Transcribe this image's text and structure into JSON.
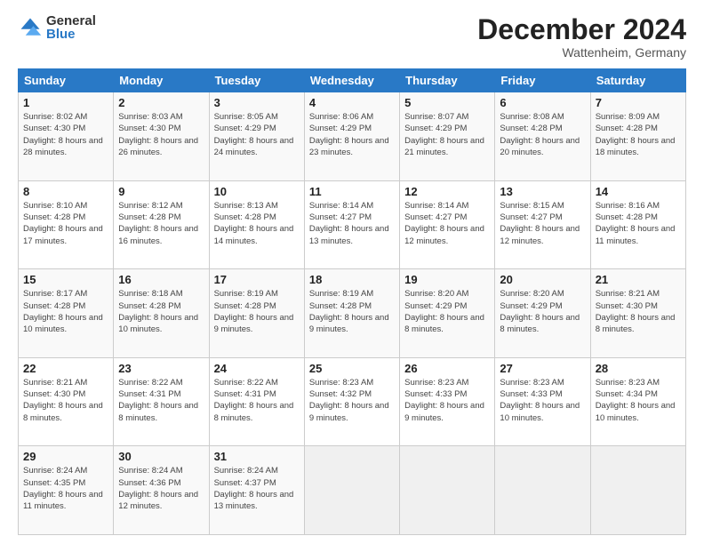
{
  "logo": {
    "general": "General",
    "blue": "Blue"
  },
  "title": "December 2024",
  "location": "Wattenheim, Germany",
  "days_of_week": [
    "Sunday",
    "Monday",
    "Tuesday",
    "Wednesday",
    "Thursday",
    "Friday",
    "Saturday"
  ],
  "weeks": [
    [
      {
        "day": "1",
        "sunrise": "8:02 AM",
        "sunset": "4:30 PM",
        "daylight": "8 hours and 28 minutes."
      },
      {
        "day": "2",
        "sunrise": "8:03 AM",
        "sunset": "4:30 PM",
        "daylight": "8 hours and 26 minutes."
      },
      {
        "day": "3",
        "sunrise": "8:05 AM",
        "sunset": "4:29 PM",
        "daylight": "8 hours and 24 minutes."
      },
      {
        "day": "4",
        "sunrise": "8:06 AM",
        "sunset": "4:29 PM",
        "daylight": "8 hours and 23 minutes."
      },
      {
        "day": "5",
        "sunrise": "8:07 AM",
        "sunset": "4:29 PM",
        "daylight": "8 hours and 21 minutes."
      },
      {
        "day": "6",
        "sunrise": "8:08 AM",
        "sunset": "4:28 PM",
        "daylight": "8 hours and 20 minutes."
      },
      {
        "day": "7",
        "sunrise": "8:09 AM",
        "sunset": "4:28 PM",
        "daylight": "8 hours and 18 minutes."
      }
    ],
    [
      {
        "day": "8",
        "sunrise": "8:10 AM",
        "sunset": "4:28 PM",
        "daylight": "8 hours and 17 minutes."
      },
      {
        "day": "9",
        "sunrise": "8:12 AM",
        "sunset": "4:28 PM",
        "daylight": "8 hours and 16 minutes."
      },
      {
        "day": "10",
        "sunrise": "8:13 AM",
        "sunset": "4:28 PM",
        "daylight": "8 hours and 14 minutes."
      },
      {
        "day": "11",
        "sunrise": "8:14 AM",
        "sunset": "4:27 PM",
        "daylight": "8 hours and 13 minutes."
      },
      {
        "day": "12",
        "sunrise": "8:14 AM",
        "sunset": "4:27 PM",
        "daylight": "8 hours and 12 minutes."
      },
      {
        "day": "13",
        "sunrise": "8:15 AM",
        "sunset": "4:27 PM",
        "daylight": "8 hours and 12 minutes."
      },
      {
        "day": "14",
        "sunrise": "8:16 AM",
        "sunset": "4:28 PM",
        "daylight": "8 hours and 11 minutes."
      }
    ],
    [
      {
        "day": "15",
        "sunrise": "8:17 AM",
        "sunset": "4:28 PM",
        "daylight": "8 hours and 10 minutes."
      },
      {
        "day": "16",
        "sunrise": "8:18 AM",
        "sunset": "4:28 PM",
        "daylight": "8 hours and 10 minutes."
      },
      {
        "day": "17",
        "sunrise": "8:19 AM",
        "sunset": "4:28 PM",
        "daylight": "8 hours and 9 minutes."
      },
      {
        "day": "18",
        "sunrise": "8:19 AM",
        "sunset": "4:28 PM",
        "daylight": "8 hours and 9 minutes."
      },
      {
        "day": "19",
        "sunrise": "8:20 AM",
        "sunset": "4:29 PM",
        "daylight": "8 hours and 8 minutes."
      },
      {
        "day": "20",
        "sunrise": "8:20 AM",
        "sunset": "4:29 PM",
        "daylight": "8 hours and 8 minutes."
      },
      {
        "day": "21",
        "sunrise": "8:21 AM",
        "sunset": "4:30 PM",
        "daylight": "8 hours and 8 minutes."
      }
    ],
    [
      {
        "day": "22",
        "sunrise": "8:21 AM",
        "sunset": "4:30 PM",
        "daylight": "8 hours and 8 minutes."
      },
      {
        "day": "23",
        "sunrise": "8:22 AM",
        "sunset": "4:31 PM",
        "daylight": "8 hours and 8 minutes."
      },
      {
        "day": "24",
        "sunrise": "8:22 AM",
        "sunset": "4:31 PM",
        "daylight": "8 hours and 8 minutes."
      },
      {
        "day": "25",
        "sunrise": "8:23 AM",
        "sunset": "4:32 PM",
        "daylight": "8 hours and 9 minutes."
      },
      {
        "day": "26",
        "sunrise": "8:23 AM",
        "sunset": "4:33 PM",
        "daylight": "8 hours and 9 minutes."
      },
      {
        "day": "27",
        "sunrise": "8:23 AM",
        "sunset": "4:33 PM",
        "daylight": "8 hours and 10 minutes."
      },
      {
        "day": "28",
        "sunrise": "8:23 AM",
        "sunset": "4:34 PM",
        "daylight": "8 hours and 10 minutes."
      }
    ],
    [
      {
        "day": "29",
        "sunrise": "8:24 AM",
        "sunset": "4:35 PM",
        "daylight": "8 hours and 11 minutes."
      },
      {
        "day": "30",
        "sunrise": "8:24 AM",
        "sunset": "4:36 PM",
        "daylight": "8 hours and 12 minutes."
      },
      {
        "day": "31",
        "sunrise": "8:24 AM",
        "sunset": "4:37 PM",
        "daylight": "8 hours and 13 minutes."
      },
      null,
      null,
      null,
      null
    ]
  ],
  "labels": {
    "sunrise": "Sunrise:",
    "sunset": "Sunset:",
    "daylight": "Daylight:"
  }
}
